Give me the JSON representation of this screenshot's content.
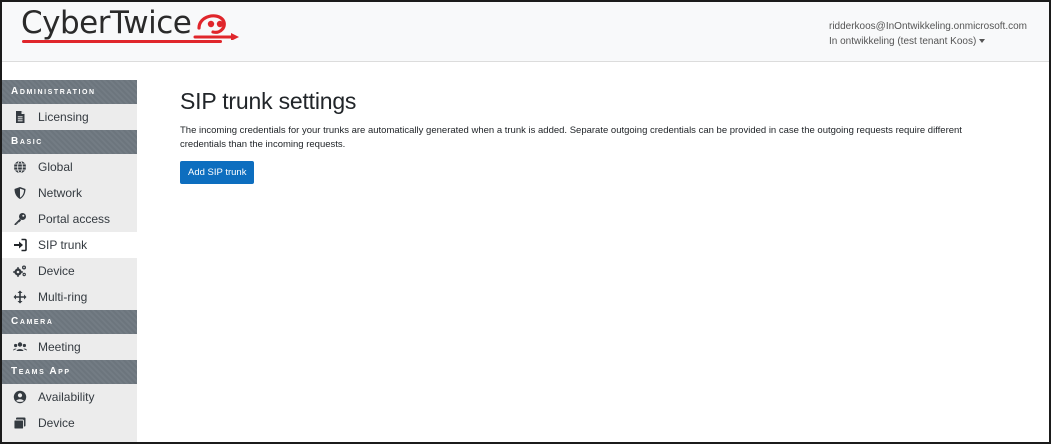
{
  "header": {
    "logo_text": "CyberTwice",
    "user_email": "ridderkoos@InOntwikkeling.onmicrosoft.com",
    "tenant_label": "In ontwikkeling (test tenant Koos)"
  },
  "sidebar": {
    "sections": [
      {
        "title": "Administration",
        "items": [
          {
            "label": "Licensing",
            "icon": "file-icon"
          }
        ]
      },
      {
        "title": "Basic",
        "items": [
          {
            "label": "Global",
            "icon": "globe-icon"
          },
          {
            "label": "Network",
            "icon": "shield-icon"
          },
          {
            "label": "Portal access",
            "icon": "key-icon"
          },
          {
            "label": "SIP trunk",
            "icon": "sign-in-icon",
            "active": true
          },
          {
            "label": "Device",
            "icon": "cogs-icon"
          },
          {
            "label": "Multi-ring",
            "icon": "arrows-icon"
          }
        ]
      },
      {
        "title": "Camera",
        "items": [
          {
            "label": "Meeting",
            "icon": "users-icon"
          }
        ]
      },
      {
        "title": "Teams App",
        "items": [
          {
            "label": "Availability",
            "icon": "user-circle-icon"
          },
          {
            "label": "Device",
            "icon": "tablet-icon"
          }
        ]
      }
    ]
  },
  "main": {
    "title": "SIP trunk settings",
    "description": "The incoming credentials for your trunks are automatically generated when a trunk is added. Separate outgoing credentials can be provided in case the outgoing requests require different credentials than the incoming requests.",
    "add_button_label": "Add SIP trunk"
  },
  "colors": {
    "accent": "#0d6ebf",
    "logo_red": "#e0262b",
    "section_header": "#6c757d",
    "sidebar_bg": "#ececec"
  }
}
